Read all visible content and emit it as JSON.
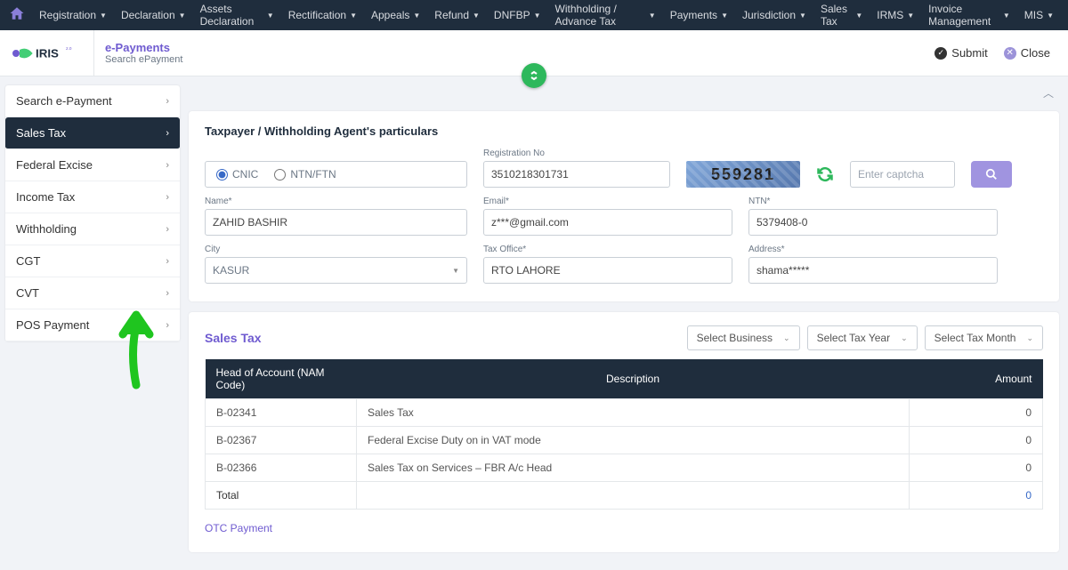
{
  "topnav": {
    "items": [
      "Registration",
      "Declaration",
      "Assets Declaration",
      "Rectification",
      "Appeals",
      "Refund",
      "DNFBP",
      "Withholding / Advance Tax",
      "Payments",
      "Jurisdiction",
      "Sales Tax",
      "IRMS",
      "Invoice Management",
      "MIS"
    ]
  },
  "subbar": {
    "title": "e-Payments",
    "subtitle": "Search ePayment",
    "submit": "Submit",
    "close": "Close"
  },
  "sidebar": {
    "items": [
      {
        "label": "Search e-Payment",
        "active": false
      },
      {
        "label": "Sales Tax",
        "active": true
      },
      {
        "label": "Federal Excise",
        "active": false
      },
      {
        "label": "Income Tax",
        "active": false
      },
      {
        "label": "Withholding",
        "active": false
      },
      {
        "label": "CGT",
        "active": false
      },
      {
        "label": "CVT",
        "active": false
      },
      {
        "label": "POS Payment",
        "active": false
      }
    ]
  },
  "particulars": {
    "heading": "Taxpayer / Withholding Agent's particulars",
    "radio_cnic": "CNIC",
    "radio_ntn": "NTN/FTN",
    "labels": {
      "regno": "Registration No",
      "name": "Name*",
      "email": "Email*",
      "ntn": "NTN*",
      "city": "City",
      "taxoffice": "Tax Office*",
      "address": "Address*"
    },
    "values": {
      "regno": "3510218301731",
      "name": "ZAHID BASHIR",
      "email": "z***@gmail.com",
      "ntn": "5379408-0",
      "city": "KASUR",
      "taxoffice": "RTO LAHORE",
      "address": "shama*****"
    },
    "captcha_value": "559281",
    "captcha_placeholder": "Enter captcha"
  },
  "salestax": {
    "title": "Sales Tax",
    "selects": {
      "business": "Select Business",
      "year": "Select Tax Year",
      "month": "Select Tax Month"
    },
    "headers": {
      "code": "Head of Account (NAM Code)",
      "desc": "Description",
      "amount": "Amount"
    },
    "rows": [
      {
        "code": "B-02341",
        "desc": "Sales Tax",
        "amount": "0"
      },
      {
        "code": "B-02367",
        "desc": "Federal Excise Duty on in VAT mode",
        "amount": "0"
      },
      {
        "code": "B-02366",
        "desc": "Sales Tax on Services – FBR A/c Head",
        "amount": "0"
      }
    ],
    "total_label": "Total",
    "total_amount": "0",
    "otc": "OTC Payment"
  }
}
